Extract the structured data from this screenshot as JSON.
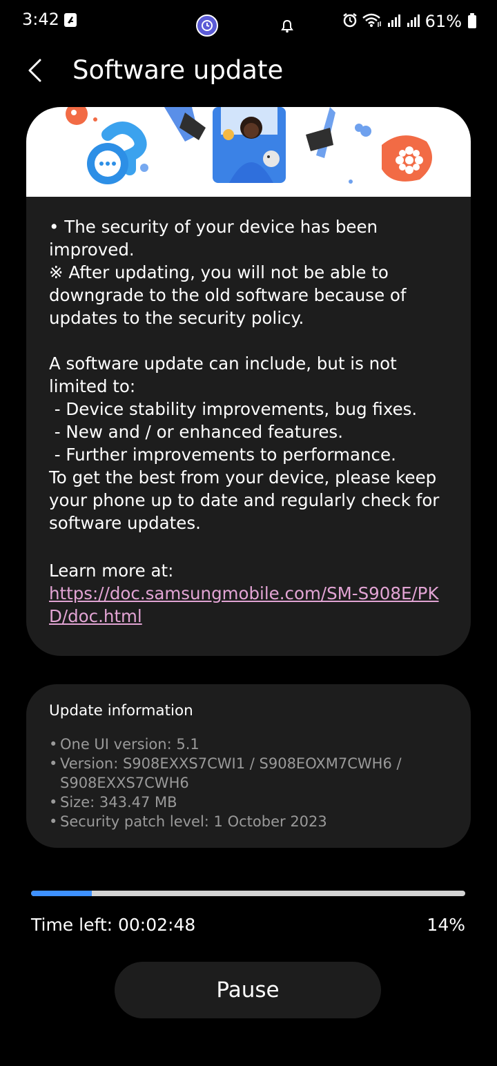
{
  "status_bar": {
    "time": "3:42",
    "battery_percent": "61%",
    "icons": [
      "flipboard-icon",
      "app-notification-icon",
      "bell-icon",
      "alarm-icon",
      "wifi-icon",
      "signal-icon",
      "signal-icon",
      "battery-icon"
    ]
  },
  "header": {
    "title": "Software update",
    "back_icon": "chevron-left-icon"
  },
  "release_notes": {
    "text": "• The security of your device has been improved.\n※ After updating, you will not be able to downgrade to the old software because of updates to the security policy.\n\nA software update can include, but is not limited to:\n - Device stability improvements, bug fixes.\n - New and / or enhanced features.\n - Further improvements to performance.\nTo get the best from your device, please keep your phone up to date and regularly check for software updates.",
    "learn_more_label": "Learn more at:",
    "learn_more_url": "https://doc.samsungmobile.com/SM-S908E/PKD/doc.html"
  },
  "update_info": {
    "title": "Update information",
    "items": [
      "One UI version: 5.1",
      "Version: S908EXXS7CWI1 / S908EOXM7CWH6 / S908EXXS7CWH6",
      "Size: 343.47 MB",
      "Security patch level: 1 October 2023"
    ]
  },
  "progress": {
    "fraction": 0.14,
    "time_left": "Time left: 00:02:48",
    "percent_label": "14%"
  },
  "pause_label": "Pause",
  "colors": {
    "background": "#000000",
    "card": "#1d1d1d",
    "progress_fill": "#3e91ff",
    "progress_track": "#d4d4d4",
    "link": "#e2a4d4"
  }
}
